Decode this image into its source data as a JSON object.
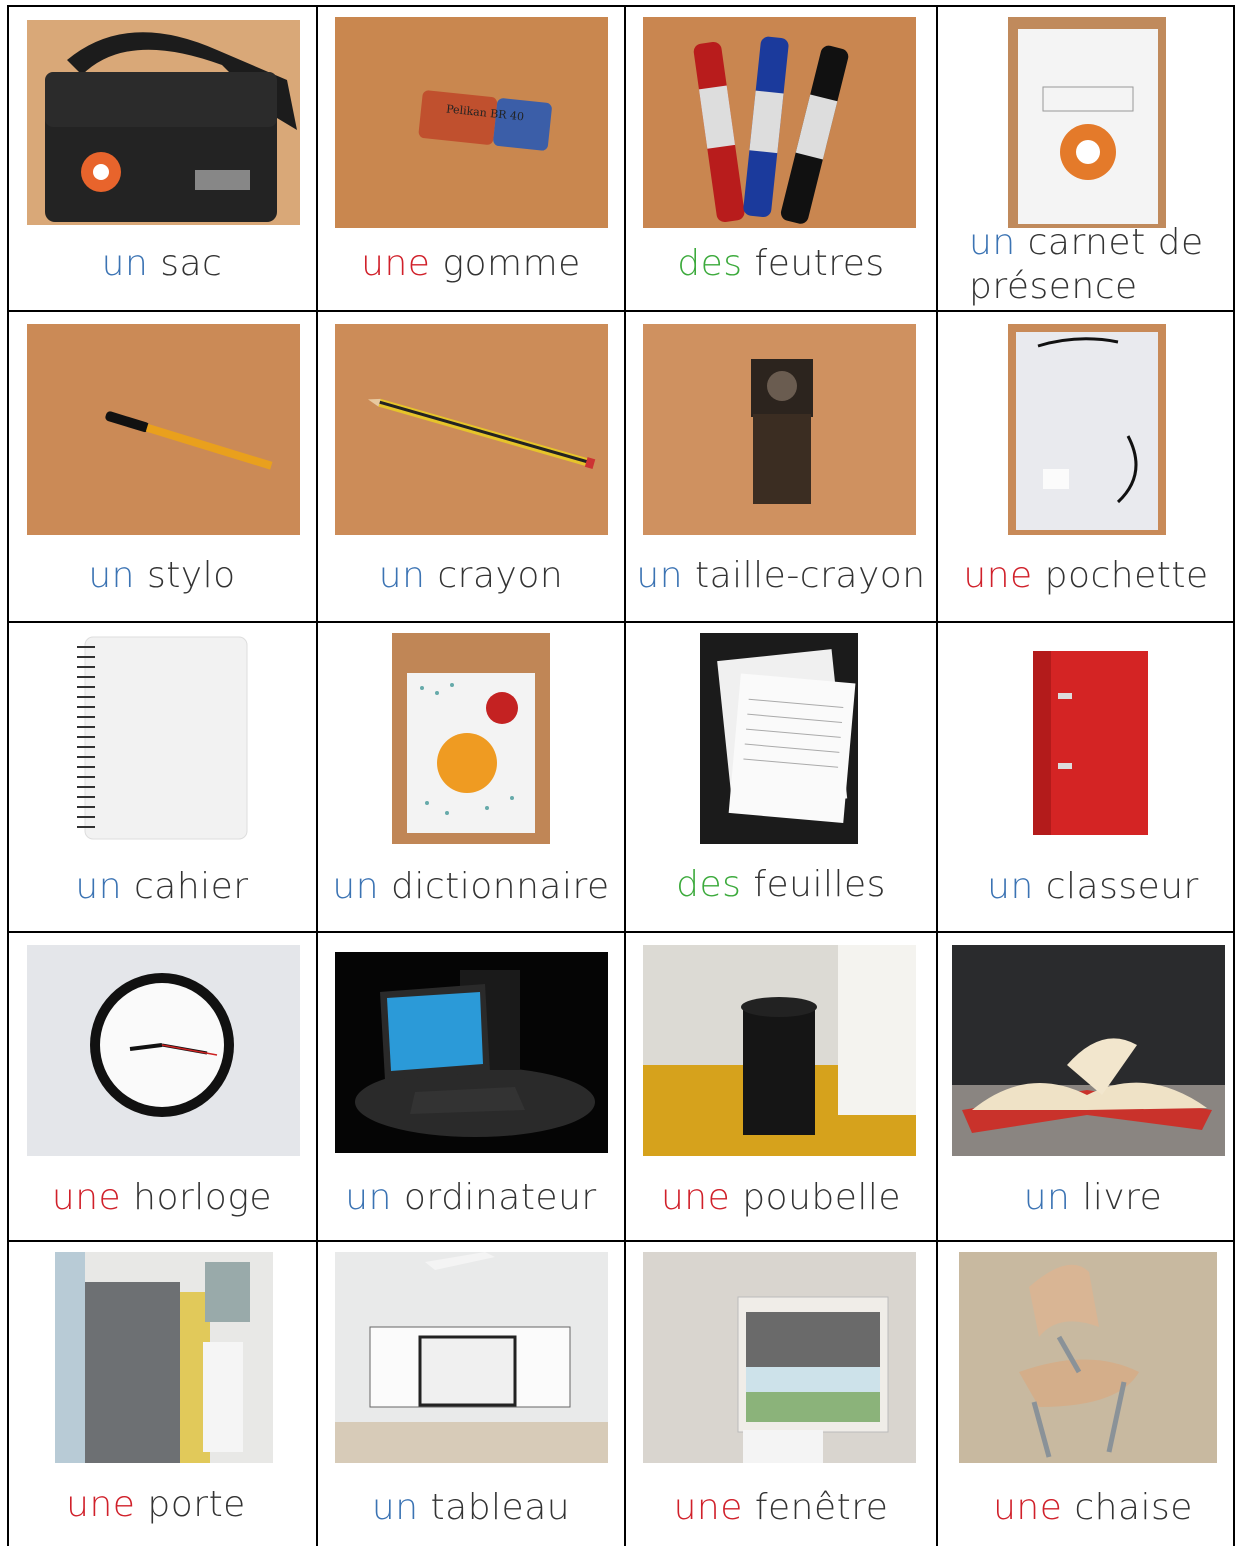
{
  "colors": {
    "masculine": "#3b73b3",
    "feminine": "#d0202a",
    "plural": "#3caa3c"
  },
  "cards": [
    {
      "article": "un",
      "gender": "masculine",
      "word": "sac",
      "icon": "bag-photo"
    },
    {
      "article": "une",
      "gender": "feminine",
      "word": "gomme",
      "icon": "eraser-photo",
      "image_text": "Pelikan BR 40"
    },
    {
      "article": "des",
      "gender": "plural",
      "word": "feutres",
      "icon": "markers-photo"
    },
    {
      "article": "un",
      "gender": "masculine",
      "word": "carnet de présence",
      "icon": "attendance-booklet-photo"
    },
    {
      "article": "un",
      "gender": "masculine",
      "word": "stylo",
      "icon": "pen-photo"
    },
    {
      "article": "un",
      "gender": "masculine",
      "word": "crayon",
      "icon": "pencil-photo"
    },
    {
      "article": "un",
      "gender": "masculine",
      "word": "taille-crayon",
      "icon": "sharpener-photo"
    },
    {
      "article": "une",
      "gender": "feminine",
      "word": "pochette",
      "icon": "folder-sleeve-photo"
    },
    {
      "article": "un",
      "gender": "masculine",
      "word": "cahier",
      "icon": "notebook-photo"
    },
    {
      "article": "un",
      "gender": "masculine",
      "word": "dictionnaire",
      "icon": "dictionary-photo"
    },
    {
      "article": "des",
      "gender": "plural",
      "word": "feuilles",
      "icon": "sheets-photo"
    },
    {
      "article": "un",
      "gender": "masculine",
      "word": "classeur",
      "icon": "binder-photo"
    },
    {
      "article": "une",
      "gender": "feminine",
      "word": "horloge",
      "icon": "clock-photo"
    },
    {
      "article": "un",
      "gender": "masculine",
      "word": "ordinateur",
      "icon": "computer-photo"
    },
    {
      "article": "une",
      "gender": "feminine",
      "word": "poubelle",
      "icon": "trash-bin-photo"
    },
    {
      "article": "un",
      "gender": "masculine",
      "word": "livre",
      "icon": "book-photo"
    },
    {
      "article": "une",
      "gender": "feminine",
      "word": "porte",
      "icon": "door-photo"
    },
    {
      "article": "un",
      "gender": "masculine",
      "word": "tableau",
      "icon": "whiteboard-photo"
    },
    {
      "article": "une",
      "gender": "feminine",
      "word": "fenêtre",
      "icon": "window-photo"
    },
    {
      "article": "une",
      "gender": "feminine",
      "word": "chaise",
      "icon": "chair-photo"
    }
  ]
}
